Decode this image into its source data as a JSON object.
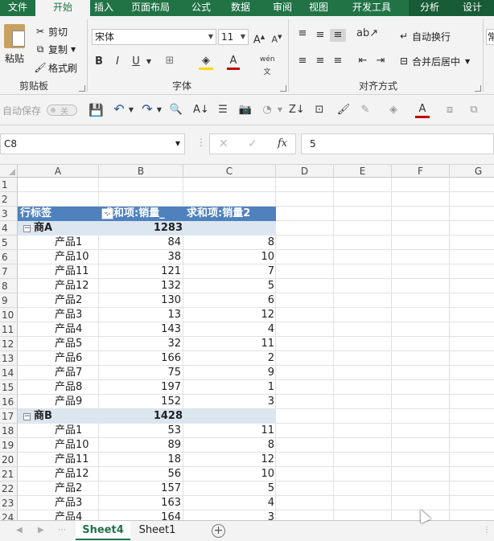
{
  "ribbon_tabs": [
    {
      "label": "文件"
    },
    {
      "label": "开始"
    },
    {
      "label": "插入"
    },
    {
      "label": "页面布局"
    },
    {
      "label": "公式"
    },
    {
      "label": "数据"
    },
    {
      "label": "审阅"
    },
    {
      "label": "视图"
    },
    {
      "label": "开发工具"
    },
    {
      "label": "分析"
    },
    {
      "label": "设计"
    }
  ],
  "clipboard": {
    "paste": "粘贴",
    "cut": "剪切",
    "copy": "复制",
    "format_painter": "格式刷",
    "group": "剪贴板"
  },
  "font": {
    "name": "宋体",
    "size": "11",
    "group": "字体",
    "bold": "B",
    "italic": "I",
    "underline": "U"
  },
  "alignment": {
    "wrap": "自动换行",
    "merge": "合并后居中",
    "group": "对齐方式",
    "cut_off": "常"
  },
  "qat": {
    "autosave": "自动保存",
    "toggle": "关"
  },
  "formula_bar": {
    "name_box": "C8",
    "value": "5",
    "fx": "fx"
  },
  "columns": [
    "A",
    "B",
    "C",
    "D",
    "E",
    "F",
    "G"
  ],
  "rows": [
    "1",
    "2",
    "3",
    "4",
    "5",
    "6",
    "7",
    "8",
    "9",
    "10",
    "11",
    "12",
    "13",
    "14",
    "15",
    "16",
    "17",
    "18",
    "19",
    "20",
    "21",
    "22",
    "23",
    "24"
  ],
  "pivot": {
    "header": {
      "row_labels": "行标签",
      "sum1": "求和项:销量_",
      "sum2": "求和项:销量2"
    },
    "groups": [
      {
        "name": "商A",
        "total": "1283",
        "items": [
          {
            "label": "产品1",
            "v1": "84",
            "v2": "8"
          },
          {
            "label": "产品10",
            "v1": "38",
            "v2": "10"
          },
          {
            "label": "产品11",
            "v1": "121",
            "v2": "7"
          },
          {
            "label": "产品12",
            "v1": "132",
            "v2": "5"
          },
          {
            "label": "产品2",
            "v1": "130",
            "v2": "6"
          },
          {
            "label": "产品3",
            "v1": "13",
            "v2": "12"
          },
          {
            "label": "产品4",
            "v1": "143",
            "v2": "4"
          },
          {
            "label": "产品5",
            "v1": "32",
            "v2": "11"
          },
          {
            "label": "产品6",
            "v1": "166",
            "v2": "2"
          },
          {
            "label": "产品7",
            "v1": "75",
            "v2": "9"
          },
          {
            "label": "产品8",
            "v1": "197",
            "v2": "1"
          },
          {
            "label": "产品9",
            "v1": "152",
            "v2": "3"
          }
        ]
      },
      {
        "name": "商B",
        "total": "1428",
        "items": [
          {
            "label": "产品1",
            "v1": "53",
            "v2": "11"
          },
          {
            "label": "产品10",
            "v1": "89",
            "v2": "8"
          },
          {
            "label": "产品11",
            "v1": "18",
            "v2": "12"
          },
          {
            "label": "产品12",
            "v1": "56",
            "v2": "10"
          },
          {
            "label": "产品2",
            "v1": "157",
            "v2": "5"
          },
          {
            "label": "产品3",
            "v1": "163",
            "v2": "4"
          },
          {
            "label": "产品4",
            "v1": "164",
            "v2": "3"
          }
        ]
      }
    ]
  },
  "sheets": [
    {
      "label": "Sheet4",
      "active": true
    },
    {
      "label": "Sheet1",
      "active": false
    }
  ],
  "colors": {
    "excel_green": "#217346",
    "pivot_header": "#4f81bd",
    "group_row": "#dce6f1"
  }
}
